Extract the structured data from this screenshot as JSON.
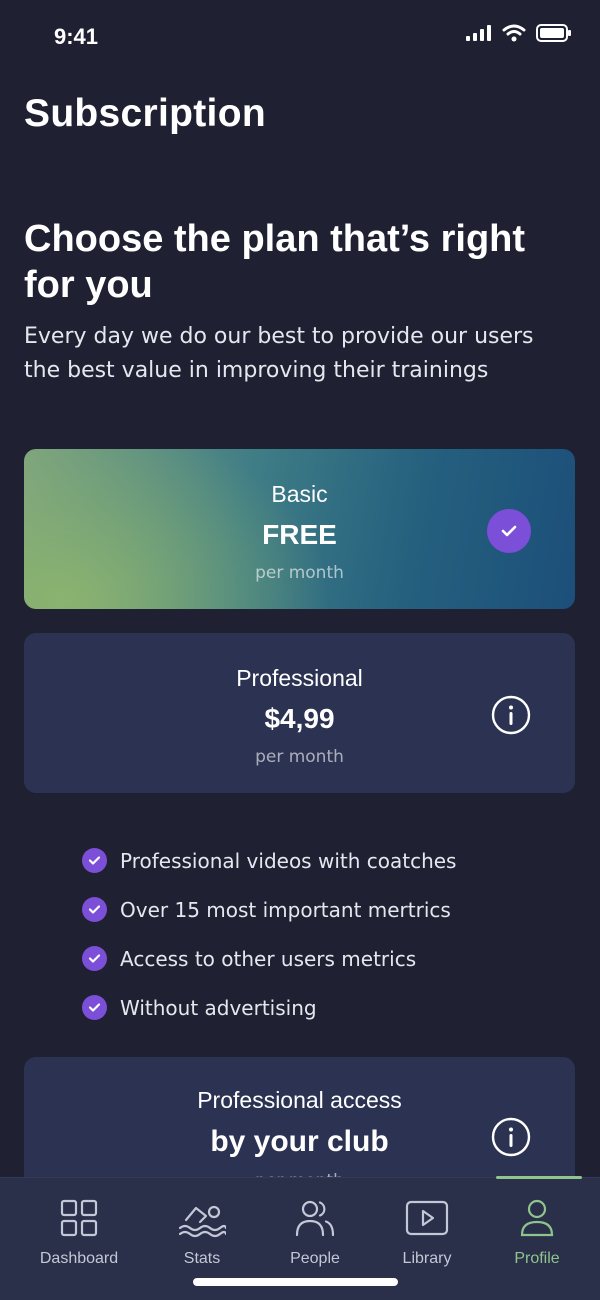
{
  "status": {
    "time": "9:41"
  },
  "page": {
    "title": "Subscription"
  },
  "intro": {
    "headline": "Choose the plan that’s right for you",
    "subhead": "Every day we do our best to provide our users the best value in improving their trainings"
  },
  "plans": [
    {
      "name": "Basic",
      "price": "FREE",
      "period": "per month",
      "selected": true
    },
    {
      "name": "Professional",
      "price": "$4,99",
      "period": "per month",
      "selected": false
    },
    {
      "name": "Professional access",
      "price": "by your club",
      "period": "per month",
      "selected": false
    }
  ],
  "features": [
    "Professional videos with coatches",
    "Over 15 most important mertrics",
    "Access to other users metrics",
    "Without advertising"
  ],
  "tabs": [
    {
      "label": "Dashboard",
      "icon": "grid-icon",
      "active": false
    },
    {
      "label": "Stats",
      "icon": "swimmer-icon",
      "active": false
    },
    {
      "label": "People",
      "icon": "people-icon",
      "active": false
    },
    {
      "label": "Library",
      "icon": "play-icon",
      "active": false
    },
    {
      "label": "Profile",
      "icon": "person-icon",
      "active": true
    }
  ],
  "colors": {
    "background": "#1f2132",
    "card": "#2c3352",
    "accent_purple": "#7c4fd8",
    "active_tab": "#8fc48d"
  }
}
